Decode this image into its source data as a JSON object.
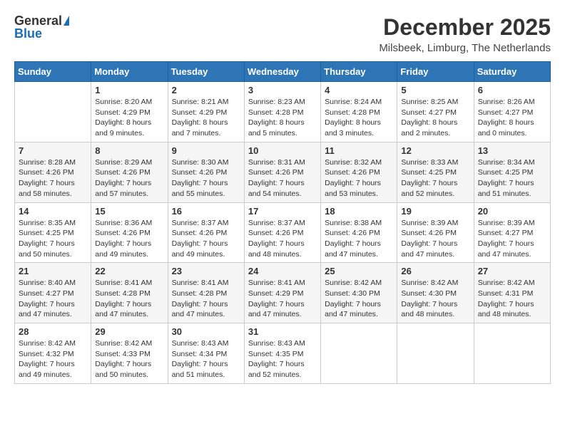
{
  "logo": {
    "general": "General",
    "blue": "Blue"
  },
  "title": {
    "month_year": "December 2025",
    "location": "Milsbeek, Limburg, The Netherlands"
  },
  "calendar": {
    "headers": [
      "Sunday",
      "Monday",
      "Tuesday",
      "Wednesday",
      "Thursday",
      "Friday",
      "Saturday"
    ],
    "rows": [
      [
        {
          "day": "",
          "sunrise": "",
          "sunset": "",
          "daylight": ""
        },
        {
          "day": "1",
          "sunrise": "Sunrise: 8:20 AM",
          "sunset": "Sunset: 4:29 PM",
          "daylight": "Daylight: 8 hours and 9 minutes."
        },
        {
          "day": "2",
          "sunrise": "Sunrise: 8:21 AM",
          "sunset": "Sunset: 4:29 PM",
          "daylight": "Daylight: 8 hours and 7 minutes."
        },
        {
          "day": "3",
          "sunrise": "Sunrise: 8:23 AM",
          "sunset": "Sunset: 4:28 PM",
          "daylight": "Daylight: 8 hours and 5 minutes."
        },
        {
          "day": "4",
          "sunrise": "Sunrise: 8:24 AM",
          "sunset": "Sunset: 4:28 PM",
          "daylight": "Daylight: 8 hours and 3 minutes."
        },
        {
          "day": "5",
          "sunrise": "Sunrise: 8:25 AM",
          "sunset": "Sunset: 4:27 PM",
          "daylight": "Daylight: 8 hours and 2 minutes."
        },
        {
          "day": "6",
          "sunrise": "Sunrise: 8:26 AM",
          "sunset": "Sunset: 4:27 PM",
          "daylight": "Daylight: 8 hours and 0 minutes."
        }
      ],
      [
        {
          "day": "7",
          "sunrise": "Sunrise: 8:28 AM",
          "sunset": "Sunset: 4:26 PM",
          "daylight": "Daylight: 7 hours and 58 minutes."
        },
        {
          "day": "8",
          "sunrise": "Sunrise: 8:29 AM",
          "sunset": "Sunset: 4:26 PM",
          "daylight": "Daylight: 7 hours and 57 minutes."
        },
        {
          "day": "9",
          "sunrise": "Sunrise: 8:30 AM",
          "sunset": "Sunset: 4:26 PM",
          "daylight": "Daylight: 7 hours and 55 minutes."
        },
        {
          "day": "10",
          "sunrise": "Sunrise: 8:31 AM",
          "sunset": "Sunset: 4:26 PM",
          "daylight": "Daylight: 7 hours and 54 minutes."
        },
        {
          "day": "11",
          "sunrise": "Sunrise: 8:32 AM",
          "sunset": "Sunset: 4:26 PM",
          "daylight": "Daylight: 7 hours and 53 minutes."
        },
        {
          "day": "12",
          "sunrise": "Sunrise: 8:33 AM",
          "sunset": "Sunset: 4:25 PM",
          "daylight": "Daylight: 7 hours and 52 minutes."
        },
        {
          "day": "13",
          "sunrise": "Sunrise: 8:34 AM",
          "sunset": "Sunset: 4:25 PM",
          "daylight": "Daylight: 7 hours and 51 minutes."
        }
      ],
      [
        {
          "day": "14",
          "sunrise": "Sunrise: 8:35 AM",
          "sunset": "Sunset: 4:25 PM",
          "daylight": "Daylight: 7 hours and 50 minutes."
        },
        {
          "day": "15",
          "sunrise": "Sunrise: 8:36 AM",
          "sunset": "Sunset: 4:26 PM",
          "daylight": "Daylight: 7 hours and 49 minutes."
        },
        {
          "day": "16",
          "sunrise": "Sunrise: 8:37 AM",
          "sunset": "Sunset: 4:26 PM",
          "daylight": "Daylight: 7 hours and 49 minutes."
        },
        {
          "day": "17",
          "sunrise": "Sunrise: 8:37 AM",
          "sunset": "Sunset: 4:26 PM",
          "daylight": "Daylight: 7 hours and 48 minutes."
        },
        {
          "day": "18",
          "sunrise": "Sunrise: 8:38 AM",
          "sunset": "Sunset: 4:26 PM",
          "daylight": "Daylight: 7 hours and 47 minutes."
        },
        {
          "day": "19",
          "sunrise": "Sunrise: 8:39 AM",
          "sunset": "Sunset: 4:26 PM",
          "daylight": "Daylight: 7 hours and 47 minutes."
        },
        {
          "day": "20",
          "sunrise": "Sunrise: 8:39 AM",
          "sunset": "Sunset: 4:27 PM",
          "daylight": "Daylight: 7 hours and 47 minutes."
        }
      ],
      [
        {
          "day": "21",
          "sunrise": "Sunrise: 8:40 AM",
          "sunset": "Sunset: 4:27 PM",
          "daylight": "Daylight: 7 hours and 47 minutes."
        },
        {
          "day": "22",
          "sunrise": "Sunrise: 8:41 AM",
          "sunset": "Sunset: 4:28 PM",
          "daylight": "Daylight: 7 hours and 47 minutes."
        },
        {
          "day": "23",
          "sunrise": "Sunrise: 8:41 AM",
          "sunset": "Sunset: 4:28 PM",
          "daylight": "Daylight: 7 hours and 47 minutes."
        },
        {
          "day": "24",
          "sunrise": "Sunrise: 8:41 AM",
          "sunset": "Sunset: 4:29 PM",
          "daylight": "Daylight: 7 hours and 47 minutes."
        },
        {
          "day": "25",
          "sunrise": "Sunrise: 8:42 AM",
          "sunset": "Sunset: 4:30 PM",
          "daylight": "Daylight: 7 hours and 47 minutes."
        },
        {
          "day": "26",
          "sunrise": "Sunrise: 8:42 AM",
          "sunset": "Sunset: 4:30 PM",
          "daylight": "Daylight: 7 hours and 48 minutes."
        },
        {
          "day": "27",
          "sunrise": "Sunrise: 8:42 AM",
          "sunset": "Sunset: 4:31 PM",
          "daylight": "Daylight: 7 hours and 48 minutes."
        }
      ],
      [
        {
          "day": "28",
          "sunrise": "Sunrise: 8:42 AM",
          "sunset": "Sunset: 4:32 PM",
          "daylight": "Daylight: 7 hours and 49 minutes."
        },
        {
          "day": "29",
          "sunrise": "Sunrise: 8:42 AM",
          "sunset": "Sunset: 4:33 PM",
          "daylight": "Daylight: 7 hours and 50 minutes."
        },
        {
          "day": "30",
          "sunrise": "Sunrise: 8:43 AM",
          "sunset": "Sunset: 4:34 PM",
          "daylight": "Daylight: 7 hours and 51 minutes."
        },
        {
          "day": "31",
          "sunrise": "Sunrise: 8:43 AM",
          "sunset": "Sunset: 4:35 PM",
          "daylight": "Daylight: 7 hours and 52 minutes."
        },
        {
          "day": "",
          "sunrise": "",
          "sunset": "",
          "daylight": ""
        },
        {
          "day": "",
          "sunrise": "",
          "sunset": "",
          "daylight": ""
        },
        {
          "day": "",
          "sunrise": "",
          "sunset": "",
          "daylight": ""
        }
      ]
    ]
  }
}
